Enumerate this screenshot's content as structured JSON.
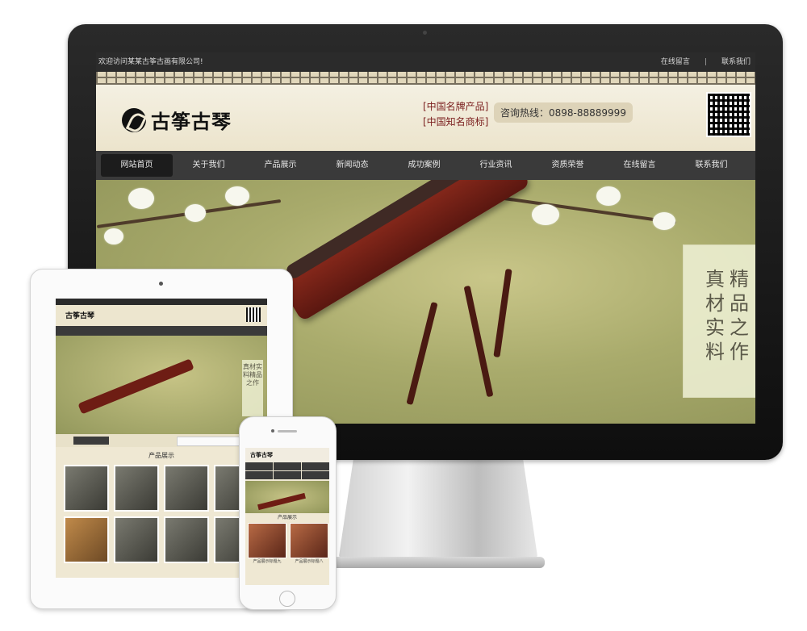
{
  "desktop": {
    "topbar": {
      "welcome": "欢迎访问某某古筝古画有限公司!",
      "links": [
        "在线留言",
        "|",
        "联系我们"
      ]
    },
    "header": {
      "logo_text": "古筝古琴",
      "brand_tags": [
        "[中国名牌产品]",
        "[中国知名商标]"
      ],
      "hotline": "咨询热线：0898-88889999"
    },
    "nav": [
      "网站首页",
      "关于我们",
      "产品展示",
      "新闻动态",
      "成功案例",
      "行业资讯",
      "资质荣誉",
      "在线留言",
      "联系我们"
    ],
    "banner": {
      "slogan_right": "精品之作",
      "slogan_left": "真材实料"
    }
  },
  "tablet": {
    "logo_text": "古筝古琴",
    "section_title": "产品展示",
    "slogan": "真材实料精品之作"
  },
  "phone": {
    "logo_text": "古筝古琴",
    "section_title": "产品展示",
    "captions": [
      "产品展示标题九",
      "产品展示标题八"
    ]
  },
  "colors": {
    "nav_bg": "#3a3a3a",
    "brand_red": "#7a1d1d",
    "banner_green": "#a9ab6c",
    "paper": "#efe8d3"
  }
}
